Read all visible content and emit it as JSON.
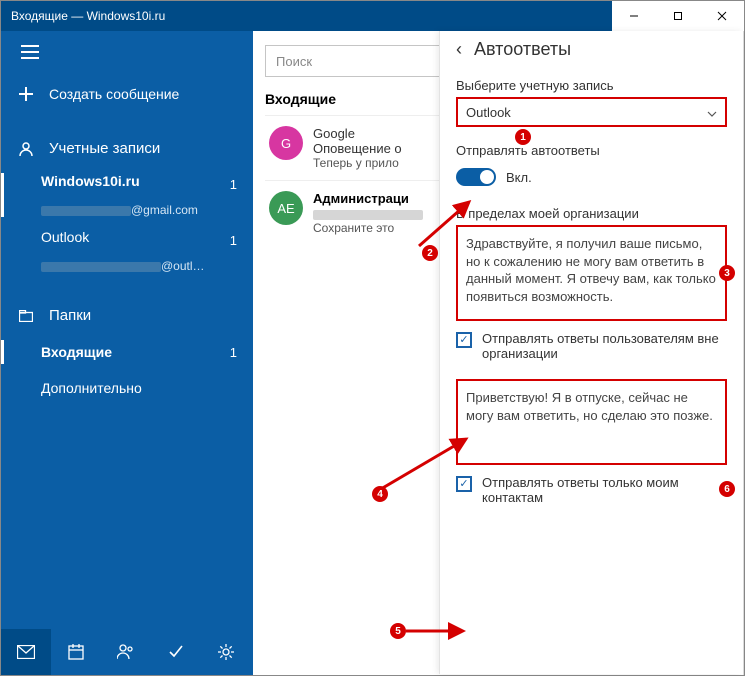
{
  "titlebar": {
    "title": "Входящие — Windows10i.ru"
  },
  "sidebar": {
    "compose": "Создать сообщение",
    "accounts_header": "Учетные записи",
    "accounts": [
      {
        "name": "Windows10i.ru",
        "email_suffix": "@gmail.com",
        "count": "1"
      },
      {
        "name": "Outlook",
        "email_suffix": "@outl…",
        "count": "1"
      }
    ],
    "folders_header": "Папки",
    "folders": [
      {
        "label": "Входящие",
        "count": "1"
      },
      {
        "label": "Дополнительно",
        "count": ""
      }
    ]
  },
  "mid": {
    "search_placeholder": "Поиск",
    "heading": "Входящие",
    "messages": [
      {
        "avatar": "G",
        "from": "Google",
        "subject": "Оповещение о",
        "preview": "Теперь у прило"
      },
      {
        "avatar": "АЕ",
        "from": "Администраци",
        "subject": "",
        "preview": "Сохраните это"
      }
    ]
  },
  "panel": {
    "title": "Автоответы",
    "account_label": "Выберите учетную запись",
    "account_value": "Outlook",
    "send_label": "Отправлять автоответы",
    "toggle_state": "Вкл.",
    "inside_org_header": "В пределах моей организации",
    "inside_org_text": "Здравствуйте, я получил ваше письмо, но к сожалению не могу вам ответить в данный момент. Я отвечу вам, как только появиться возможность.",
    "outside_org_chk": "Отправлять ответы пользователям вне организации",
    "outside_org_text": "Приветствую! Я в отпуске, сейчас не могу вам ответить, но сделаю это позже.",
    "only_contacts_chk": "Отправлять ответы только моим контактам"
  },
  "annotations": {
    "m1": "1",
    "m2": "2",
    "m3": "3",
    "m4": "4",
    "m5": "5",
    "m6": "6"
  }
}
